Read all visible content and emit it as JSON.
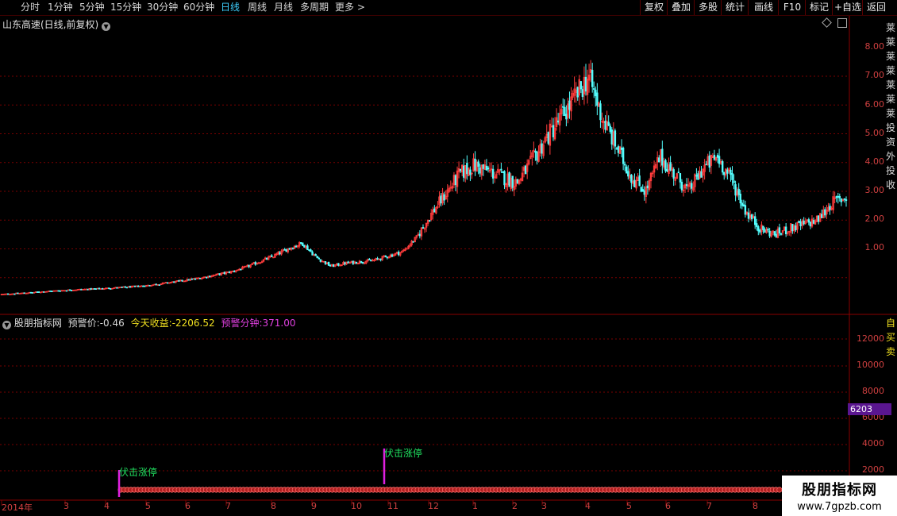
{
  "toolbar": {
    "periods": [
      "分时",
      "1分钟",
      "5分钟",
      "15分钟",
      "30分钟",
      "60分钟",
      "日线",
      "周线",
      "月线",
      "多周期",
      "更多 >"
    ],
    "active_period": "日线",
    "right_buttons": [
      "复权",
      "叠加",
      "多股",
      "统计",
      "画线",
      "F10",
      "标记",
      "+自选",
      "返回"
    ]
  },
  "main_panel": {
    "title": "山东高速(日线,前复权)",
    "y_ticks": [
      "8.00",
      "7.00",
      "6.00",
      "5.00",
      "4.00",
      "3.00",
      "2.00",
      "1.00"
    ],
    "right_side_text": "莱莱莱莱莱莱莱投资外投收"
  },
  "indicator_panel": {
    "title": "股朋指标网",
    "items": [
      {
        "label": "预警价:",
        "value": "-0.46",
        "color": "#d8d8d8"
      },
      {
        "label": "今天收益:",
        "value": "-2206.52",
        "color": "#f0e020"
      },
      {
        "label": "预警分钟:",
        "value": "371.00",
        "color": "#e040e0"
      }
    ],
    "y_ticks": [
      "12000",
      "10000",
      "8000",
      "6000",
      "4000",
      "2000"
    ],
    "cursor_value": "6203",
    "signal_label": "伏击涨停",
    "right_side_text": "自买卖"
  },
  "x_axis": {
    "labels": [
      "2014年",
      "3",
      "4",
      "5",
      "6",
      "7",
      "8",
      "9",
      "10",
      "11",
      "12",
      "1",
      "2",
      "3",
      "4",
      "5",
      "6",
      "7",
      "8"
    ]
  },
  "watermark": {
    "title": "股朋指标网",
    "url": "www.7gpzb.com"
  },
  "colors": {
    "up": "#ff3c3c",
    "down": "#54ffff",
    "grid": "#7a0000",
    "signal": "#e020e0",
    "signal_text": "#20e060"
  },
  "chart_data": {
    "type": "candlestick",
    "title": "山东高速(日线,前复权)",
    "ylim": [
      0,
      8.5
    ],
    "y_ticks": [
      1,
      2,
      3,
      4,
      5,
      6,
      7,
      8
    ],
    "closes": [
      0.42,
      0.45,
      0.48,
      0.52,
      0.55,
      0.58,
      0.6,
      0.62,
      0.65,
      0.68,
      0.72,
      0.78,
      0.85,
      0.92,
      1.0,
      1.1,
      1.2,
      1.35,
      1.55,
      1.75,
      2.0,
      2.2,
      1.7,
      1.4,
      1.5,
      1.55,
      1.6,
      1.75,
      1.9,
      2.4,
      3.2,
      3.9,
      4.6,
      4.9,
      4.7,
      4.5,
      4.3,
      5.0,
      5.8,
      6.5,
      7.2,
      8.0,
      6.5,
      5.5,
      4.5,
      4.0,
      5.2,
      4.6,
      4.0,
      4.8,
      5.2,
      4.4,
      3.3,
      2.7,
      2.5,
      2.7,
      2.85,
      3.0,
      3.6,
      3.8
    ]
  }
}
